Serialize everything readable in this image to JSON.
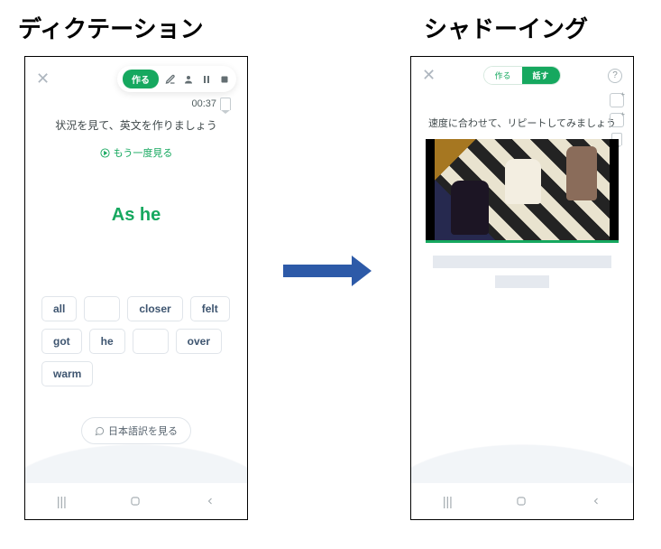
{
  "labels": {
    "left": "ディクテーション",
    "right": "シャドーイング"
  },
  "left_phone": {
    "pill_label": "作る",
    "timer": "00:37",
    "instruction": "状況を見て、英文を作りましょう",
    "see_again": "もう一度見る",
    "current_text": "As he",
    "words": [
      "all",
      "",
      "closer",
      "felt",
      "got",
      "he",
      "",
      "over",
      "warm"
    ],
    "show_jp": "日本語訳を見る"
  },
  "right_phone": {
    "tab_make": "作る",
    "tab_speak": "話す",
    "instruction": "速度に合わせて、リピートしてみましょう"
  }
}
